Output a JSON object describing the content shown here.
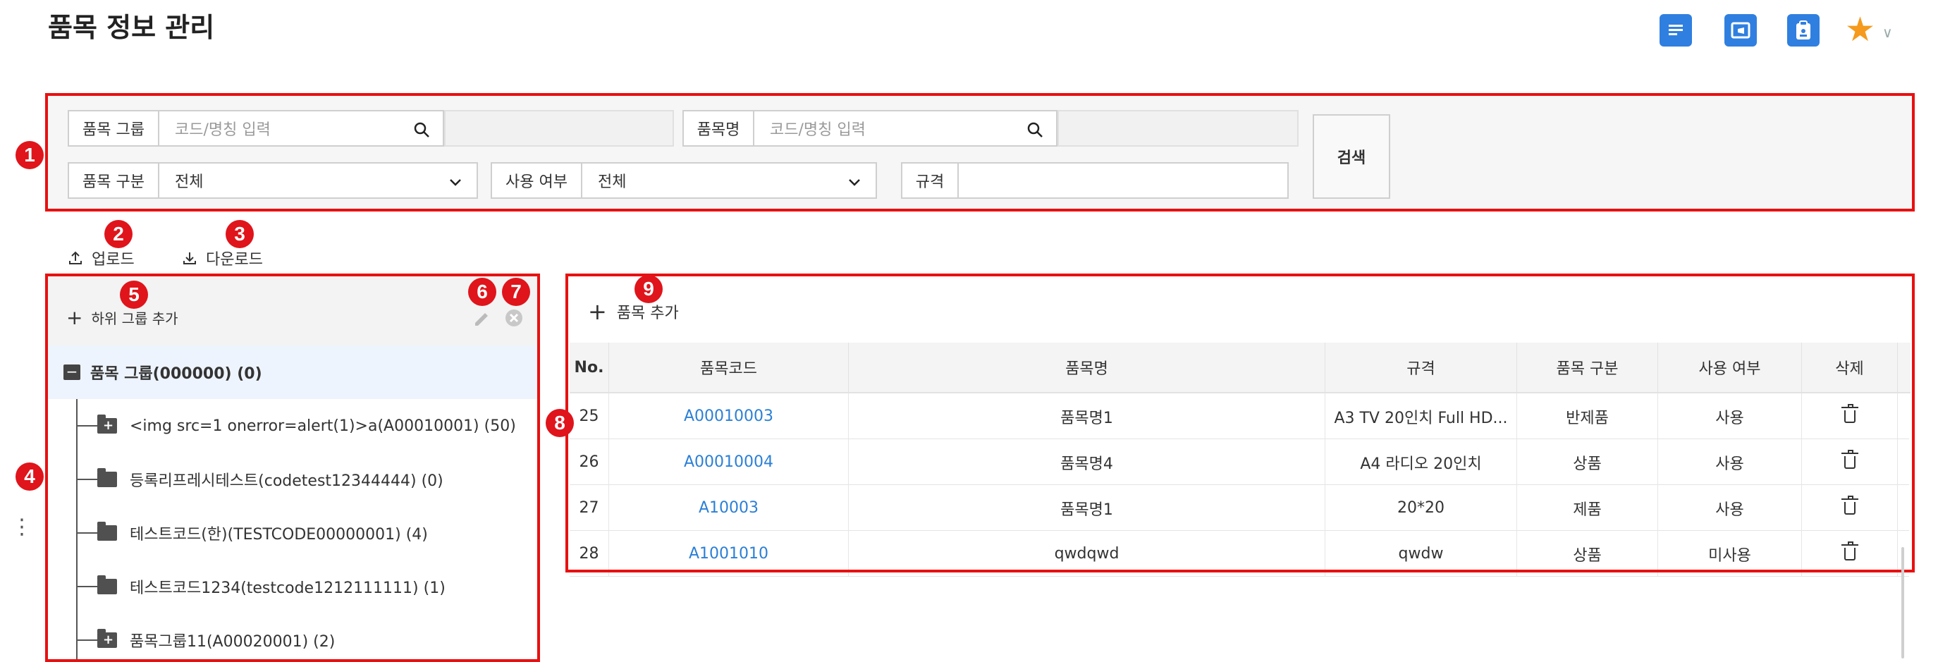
{
  "page": {
    "title": "품목 정보 관리"
  },
  "header_icons": [
    "document-icon",
    "calendar-icon",
    "clipboard-icon",
    "star-icon",
    "chevron-down-icon"
  ],
  "colors": {
    "accent": "#2f7fe0",
    "annotation_red": "#e81010",
    "link": "#2b7fd6",
    "star": "#f59a1c"
  },
  "badges": [
    "1",
    "2",
    "3",
    "4",
    "5",
    "6",
    "7",
    "8",
    "9"
  ],
  "search": {
    "item_group_label": "품목 그룹",
    "item_group_placeholder": "코드/명칭 입력",
    "item_name_label": "품목명",
    "item_name_placeholder": "코드/명칭 입력",
    "item_type_label": "품목 구분",
    "item_type_value": "전체",
    "use_label": "사용 여부",
    "use_value": "전체",
    "spec_label": "규격",
    "spec_value": "",
    "search_button": "검색"
  },
  "toolbar": {
    "upload": "업로드",
    "download": "다운로드"
  },
  "tree": {
    "add_subgroup": "하위 그룹 추가",
    "root": "품목 그룹(000000) (0)",
    "items": [
      {
        "label": "<img src=1 onerror=alert(1)>a(A00010001) (50)",
        "expandable": true
      },
      {
        "label": "등록리프레시테스트(codetest12344444) (0)",
        "expandable": false
      },
      {
        "label": "테스트코드(한)(TESTCODE00000001) (4)",
        "expandable": false
      },
      {
        "label": "테스트코드1234(testcode1212111111) (1)",
        "expandable": false
      },
      {
        "label": "품목그룹11(A00020001) (2)",
        "expandable": true
      }
    ]
  },
  "table": {
    "add_button": "품목 추가",
    "columns": [
      "No.",
      "품목코드",
      "품목명",
      "규격",
      "품목 구분",
      "사용 여부",
      "삭제"
    ],
    "rows": [
      {
        "no": "25",
        "code": "A00010003",
        "name": "품목명1",
        "spec": "A3 TV 20인치 Full HD...",
        "type": "반제품",
        "use": "사용"
      },
      {
        "no": "26",
        "code": "A00010004",
        "name": "품목명4",
        "spec": "A4 라디오 20인치",
        "type": "상품",
        "use": "사용"
      },
      {
        "no": "27",
        "code": "A10003",
        "name": "품목명1",
        "spec": "20*20",
        "type": "제품",
        "use": "사용"
      },
      {
        "no": "28",
        "code": "A1001010",
        "name": "qwdqwd",
        "spec": "qwdw",
        "type": "상품",
        "use": "미사용"
      }
    ]
  },
  "side_menu_glyph": "⋮"
}
